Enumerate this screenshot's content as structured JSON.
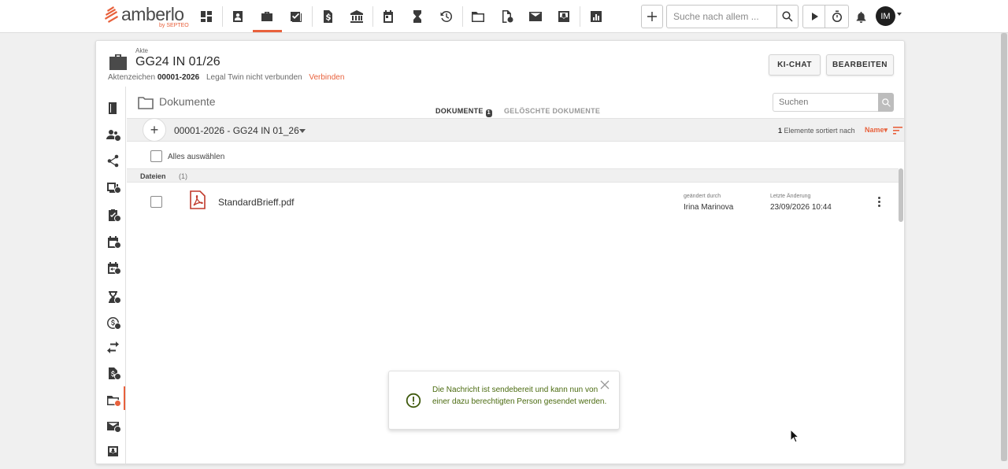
{
  "app": {
    "logo_text": "amberlo",
    "logo_sub": "by SEPTEO",
    "accent_color": "#e8613c"
  },
  "topbar": {
    "nav_icons": [
      "dashboard-icon",
      "contacts-icon",
      "briefcase-icon",
      "tasks-icon",
      "billing-icon",
      "bank-icon",
      "calendar-icon",
      "hourglass-icon",
      "history-icon",
      "folder-icon",
      "settings-folder-icon",
      "mail-icon",
      "inbox-icon",
      "reports-icon"
    ],
    "active_nav": "briefcase-icon",
    "search_placeholder": "Suche nach allem ...",
    "avatar_initials": "IM"
  },
  "header": {
    "label": "Akte",
    "title": "GG24 IN 01/26",
    "aktenzeichen_label": "Aktenzeichen",
    "aktenzeichen_value": "00001-2026",
    "legal_twin_text": "Legal Twin nicht verbunden",
    "connect_link": "Verbinden",
    "ki_chat_button": "KI-CHAT",
    "edit_button": "BEARBEITEN"
  },
  "sidebar": {
    "items": [
      "notebook-icon",
      "participants-icon",
      "share-icon",
      "documents-badge-icon",
      "tasks-badge-icon",
      "calendar-badge-icon",
      "calendar-transfer-icon",
      "hourglass-badge-icon",
      "billing-time-icon",
      "transfer-icon",
      "fees-icon",
      "folder-active-icon",
      "mail-badge-icon",
      "inbox-icon"
    ],
    "active_item": "folder-active-icon"
  },
  "documents": {
    "title": "Dokumente",
    "tabs": [
      {
        "label": "DOKUMENTE",
        "badge": "1",
        "active": true
      },
      {
        "label": "GELÖSCHTE DOKUMENTE",
        "active": false
      }
    ],
    "search_placeholder": "Suchen",
    "folder_path": "00001-2026 - GG24 IN 01_26",
    "count": "1",
    "sort_text": "Elemente sortiert nach",
    "sort_field": "Name",
    "select_all_label": "Alles auswählen",
    "group_label": "Dateien",
    "group_count": "(1)",
    "files": [
      {
        "name": "StandardBrieff.pdf",
        "changed_by_label": "geändert durch",
        "changed_by": "Irina Marinova",
        "last_change_label": "Letzte Änderung",
        "last_change": "23/09/2026 10:44"
      }
    ]
  },
  "toast": {
    "message": "Die Nachricht ist sendebereit und kann nun von einer dazu berechtigten Person gesendet werden.",
    "text_color": "#4b6b10"
  }
}
